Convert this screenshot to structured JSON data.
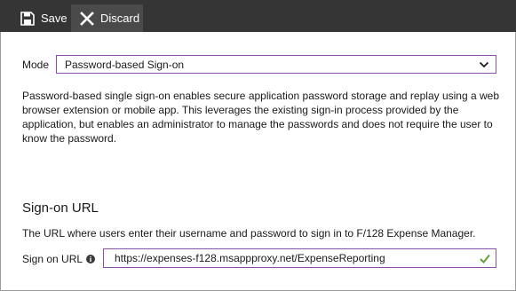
{
  "toolbar": {
    "save_label": "Save",
    "save_icon": "save-icon",
    "discard_label": "Discard",
    "discard_icon": "close-icon"
  },
  "mode": {
    "label": "Mode",
    "selected": "Password-based Sign-on"
  },
  "description": "Password-based single sign-on enables secure application password storage and replay using a web browser extension or mobile app. This leverages the existing sign-in process provided by the application, but enables an administrator to manage the passwords and does not require the user to know the password.",
  "sign_on": {
    "title": "Sign-on URL",
    "description": "The URL where users enter their username and password to sign in to F/128 Expense Manager.",
    "field_label": "Sign on URL",
    "field_value": "https://expenses-f128.msappproxy.net/ExpenseReporting",
    "valid": true
  },
  "colors": {
    "toolbar_bg": "#353535",
    "field_border": "#8a4fa8",
    "valid_check": "#5ea43a"
  }
}
